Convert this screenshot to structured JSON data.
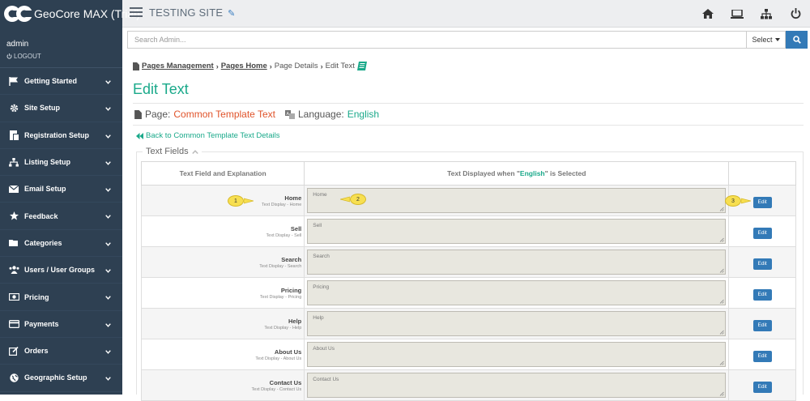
{
  "brand": {
    "name": "GeoCore MAX (Trial)"
  },
  "header": {
    "site_title": "TESTING SITE",
    "icons": [
      "home-icon",
      "laptop-icon",
      "sitemap-icon",
      "power-icon"
    ]
  },
  "user": {
    "name": "admin",
    "logout_label": "LOGOUT"
  },
  "sidebar": {
    "items": [
      {
        "label": "Getting Started",
        "icon": "flag-icon"
      },
      {
        "label": "Site Setup",
        "icon": "gear-icon"
      },
      {
        "label": "Registration Setup",
        "icon": "registration-icon"
      },
      {
        "label": "Listing Setup",
        "icon": "sitemap-icon"
      },
      {
        "label": "Email Setup",
        "icon": "envelope-icon"
      },
      {
        "label": "Feedback",
        "icon": "star-icon"
      },
      {
        "label": "Categories",
        "icon": "folder-icon"
      },
      {
        "label": "Users / User Groups",
        "icon": "users-icon"
      },
      {
        "label": "Pricing",
        "icon": "money-icon"
      },
      {
        "label": "Payments",
        "icon": "credit-card-icon"
      },
      {
        "label": "Orders",
        "icon": "edit-icon"
      },
      {
        "label": "Geographic Setup",
        "icon": "globe-icon"
      }
    ]
  },
  "search": {
    "placeholder": "Search Admin...",
    "select_label": "Select"
  },
  "breadcrumb": {
    "items": [
      "Pages Management",
      "Pages Home",
      "Page Details",
      "Edit Text"
    ]
  },
  "page": {
    "title": "Edit Text",
    "page_label": "Page:",
    "page_name": "Common Template Text",
    "language_label": "Language:",
    "language_name": "English",
    "back_link": "Back to Common Template Text Details"
  },
  "fields_section": {
    "legend": "Text Fields",
    "col1_header": "Text Field and Explanation",
    "col2_header_prefix": "Text Displayed when \"",
    "col2_header_lang": "English",
    "col2_header_suffix": "\" is Selected",
    "edit_label": "Edit",
    "rows": [
      {
        "name": "Home",
        "sub": "Text Display - Home",
        "value": "Home"
      },
      {
        "name": "Sell",
        "sub": "Text Display - Sell",
        "value": "Sell"
      },
      {
        "name": "Search",
        "sub": "Text Display - Search",
        "value": "Search"
      },
      {
        "name": "Pricing",
        "sub": "Text Display - Pricing",
        "value": "Pricing"
      },
      {
        "name": "Help",
        "sub": "Text Display - Help",
        "value": "Help"
      },
      {
        "name": "About Us",
        "sub": "Text Display - About Us",
        "value": "About Us"
      },
      {
        "name": "Contact Us",
        "sub": "Text Display - Contact Us",
        "value": "Contact Us"
      }
    ]
  },
  "callouts": [
    "1",
    "2",
    "3"
  ],
  "colors": {
    "sidebar": "#2e4052",
    "accent_green": "#1aa98a",
    "accent_orange": "#e0532a",
    "button_blue": "#337ab7",
    "callout_yellow": "#f7df50"
  }
}
